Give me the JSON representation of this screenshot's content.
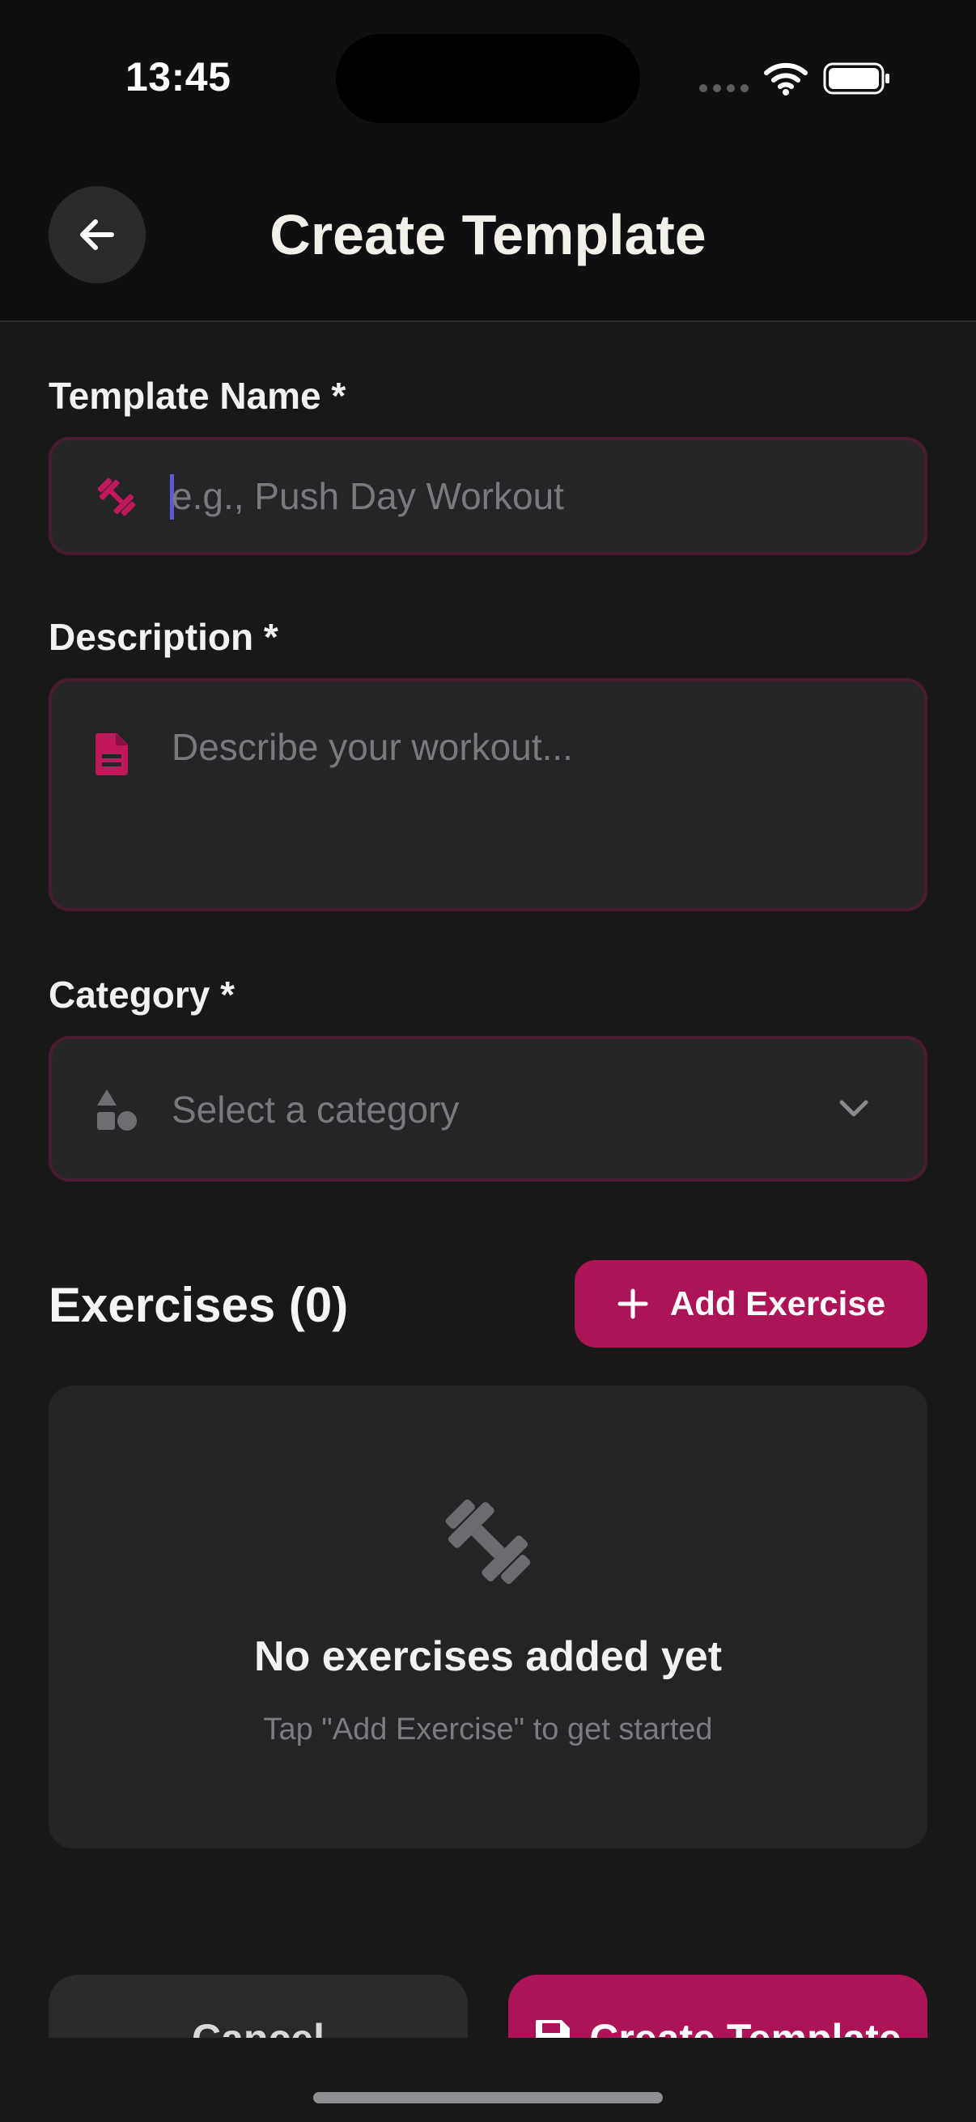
{
  "status_bar": {
    "time": "13:45",
    "icons": [
      "signal-dots-icon",
      "wifi-icon",
      "battery-icon"
    ]
  },
  "header": {
    "title": "Create Template",
    "back_icon": "arrow-left-icon"
  },
  "form": {
    "template_name": {
      "label": "Template Name *",
      "value": "",
      "placeholder": "e.g., Push Day Workout",
      "icon": "dumbbell-icon"
    },
    "description": {
      "label": "Description *",
      "value": "",
      "placeholder": "Describe your workout...",
      "icon": "document-icon"
    },
    "category": {
      "label": "Category *",
      "selected": "",
      "placeholder": "Select a category",
      "icon": "shapes-icon",
      "dropdown_icon": "chevron-down-icon"
    }
  },
  "exercises": {
    "title": "Exercises (0)",
    "add_button_label": "Add Exercise",
    "add_icon": "plus-icon",
    "empty_state": {
      "icon": "dumbbell-icon",
      "title": "No exercises added yet",
      "subtitle": "Tap \"Add Exercise\" to get started"
    }
  },
  "footer": {
    "cancel_label": "Cancel",
    "create_label": "Create Template",
    "create_icon": "save-icon"
  },
  "colors": {
    "accent": "#ad1457",
    "background": "#181819",
    "surface": "#252527",
    "input_border": "#4a1a30",
    "placeholder": "#7a7a7e"
  }
}
